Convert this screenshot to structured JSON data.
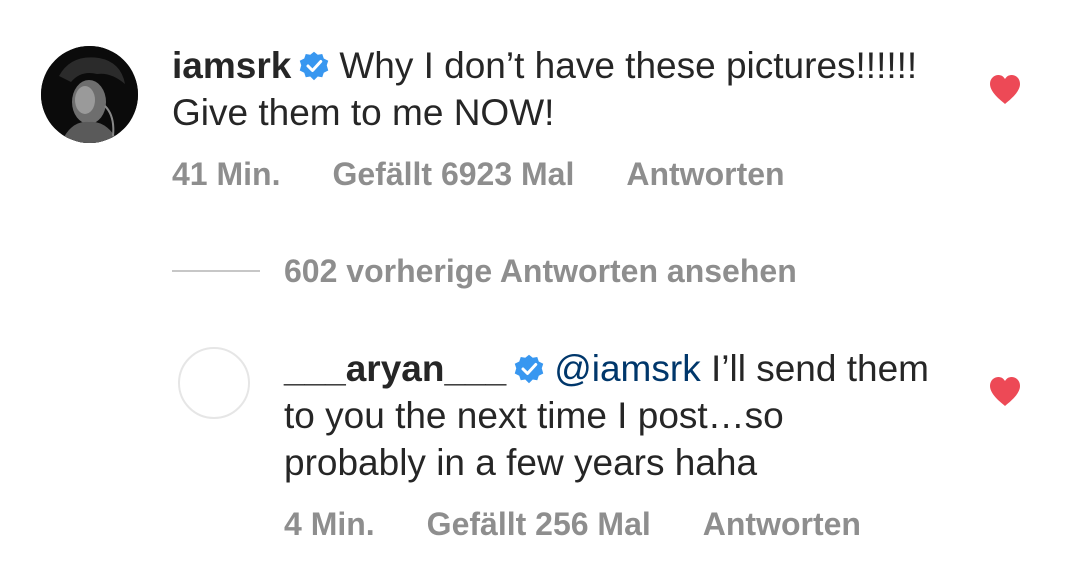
{
  "colors": {
    "text": "#262626",
    "secondary_text": "#8e8e8e",
    "mention": "#00376b",
    "heart": "#ed4956",
    "verified_badge": "#3897f0"
  },
  "comment": {
    "username": "iamsrk",
    "verified_icon": "verified-badge-icon",
    "text": "Why I don’t have these pictures!!!!!! Give them to me NOW!",
    "time": "41 Min.",
    "likes": "Gefällt 6923 Mal",
    "reply_label": "Antworten",
    "liked_icon": "heart-icon"
  },
  "view_replies": {
    "label": "602 vorherige Antworten ansehen"
  },
  "reply": {
    "username": "___aryan___",
    "verified_icon": "verified-badge-icon",
    "mention": "@iamsrk",
    "text": " I’ll send them to you the next time I post…so probably in a few years haha",
    "time": "4 Min.",
    "likes": "Gefällt 256 Mal",
    "reply_label": "Antworten",
    "liked_icon": "heart-icon"
  }
}
